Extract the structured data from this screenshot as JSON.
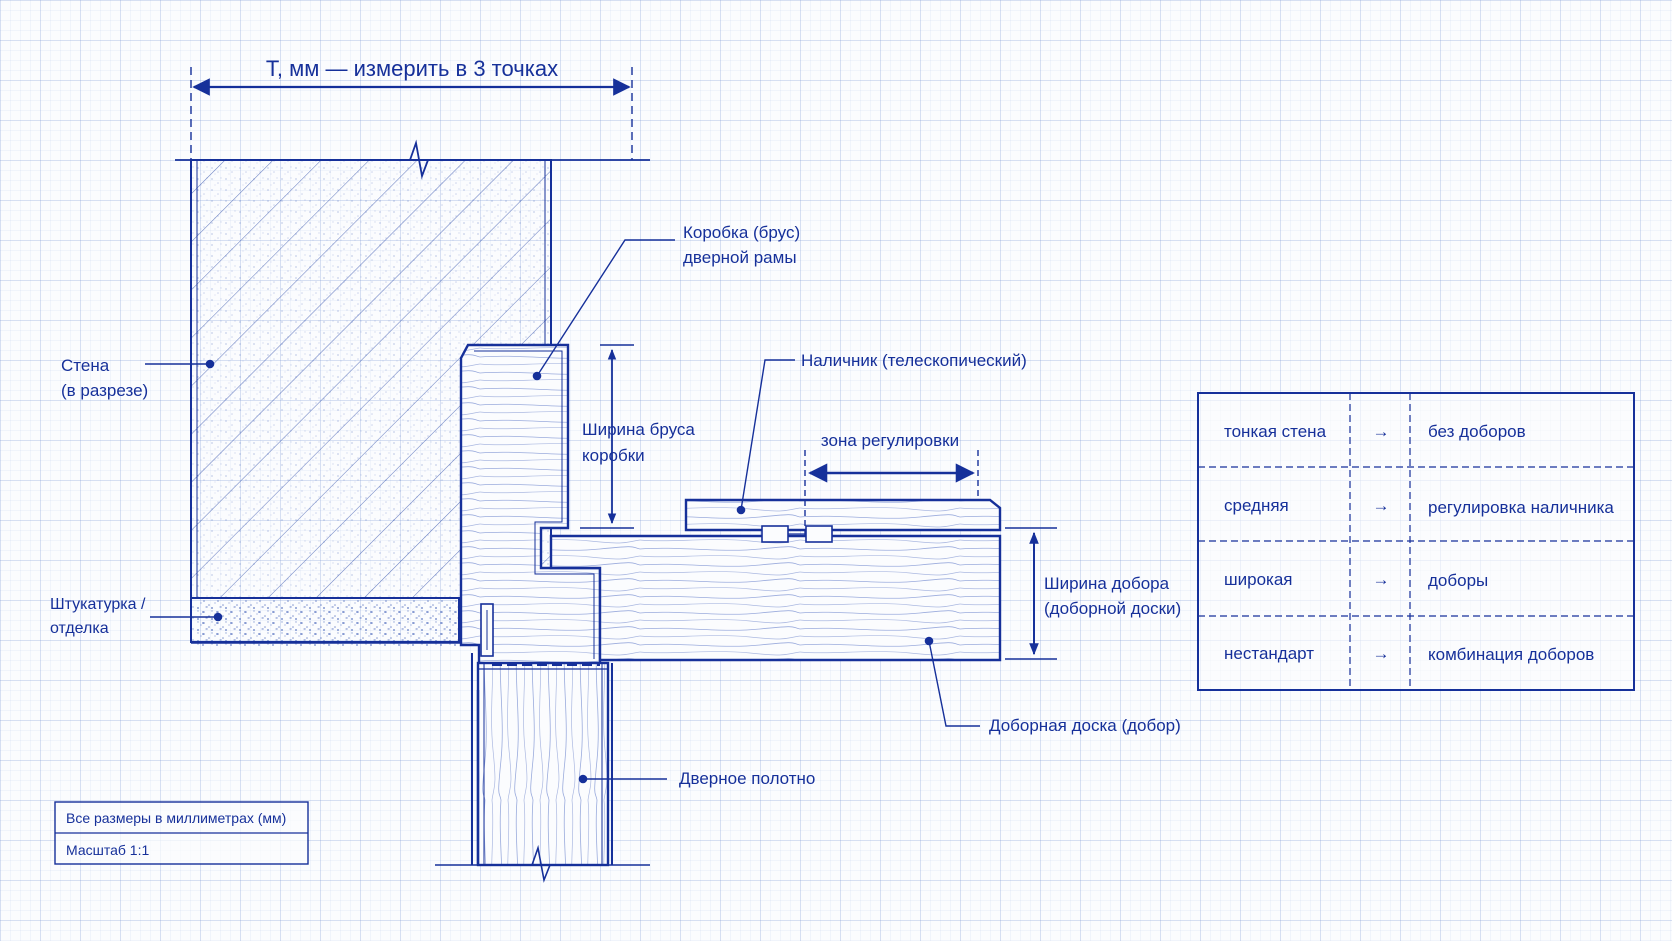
{
  "colors": {
    "ink": "#16309a",
    "paper": "#fbfcfe",
    "grid": "#9fb4e0"
  },
  "dimension_top": "T, мм — измерить в 3 точках",
  "labels": {
    "frame_line1": "Коробка (брус)",
    "frame_line2": "дверной рамы",
    "wall_line1": "Стена",
    "wall_line2": "(в разрезе)",
    "frame_width_line1": "Ширина бруса",
    "frame_width_line2": "коробки",
    "casing": "Наличник (телескопический)",
    "adjust_zone": "зона регулировки",
    "plaster_line1": "Штукатурка /",
    "plaster_line2": "отделка",
    "extension_width_line1": "Ширина добора",
    "extension_width_line2": "(доборной доски)",
    "extension_board": "Доборная доска (добор)",
    "door_leaf": "Дверное полотно"
  },
  "table": {
    "arrow": "→",
    "rows": [
      {
        "wall": "тонкая стена",
        "solution": "без доборов"
      },
      {
        "wall": "средняя",
        "solution": "регулировка наличника"
      },
      {
        "wall": "широкая",
        "solution": "доборы"
      },
      {
        "wall": "нестандарт",
        "solution": "комбинация доборов"
      }
    ]
  },
  "note": {
    "units": "Все размеры в миллиметрах (мм)",
    "scale": "Масштаб 1:1"
  }
}
